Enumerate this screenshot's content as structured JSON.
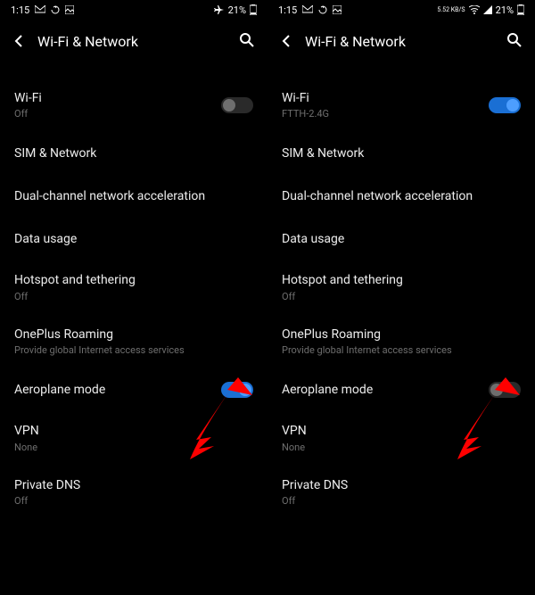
{
  "left": {
    "status": {
      "time": "1:15",
      "battery": "21%"
    },
    "header": {
      "title": "Wi-Fi & Network"
    },
    "items": [
      {
        "label": "Wi-Fi",
        "sub": "Off",
        "toggle": "off"
      },
      {
        "label": "SIM & Network",
        "sub": ""
      },
      {
        "label": "Dual-channel network acceleration",
        "sub": ""
      },
      {
        "label": "Data usage",
        "sub": ""
      },
      {
        "label": "Hotspot and tethering",
        "sub": "Off"
      },
      {
        "label": "OnePlus Roaming",
        "sub": "Provide global Internet access services"
      },
      {
        "label": "Aeroplane mode",
        "sub": "",
        "toggle": "on"
      },
      {
        "label": "VPN",
        "sub": "None"
      },
      {
        "label": "Private DNS",
        "sub": "Off"
      }
    ]
  },
  "right": {
    "status": {
      "time": "1:15",
      "speed": "5.52 KB/S",
      "battery": "21%"
    },
    "header": {
      "title": "Wi-Fi & Network"
    },
    "items": [
      {
        "label": "Wi-Fi",
        "sub": "FTTH-2.4G",
        "toggle": "on"
      },
      {
        "label": "SIM & Network",
        "sub": ""
      },
      {
        "label": "Dual-channel network acceleration",
        "sub": ""
      },
      {
        "label": "Data usage",
        "sub": ""
      },
      {
        "label": "Hotspot and tethering",
        "sub": "Off"
      },
      {
        "label": "OnePlus Roaming",
        "sub": "Provide global Internet access services"
      },
      {
        "label": "Aeroplane mode",
        "sub": "",
        "toggle": "off"
      },
      {
        "label": "VPN",
        "sub": "None"
      },
      {
        "label": "Private DNS",
        "sub": "Off"
      }
    ]
  }
}
